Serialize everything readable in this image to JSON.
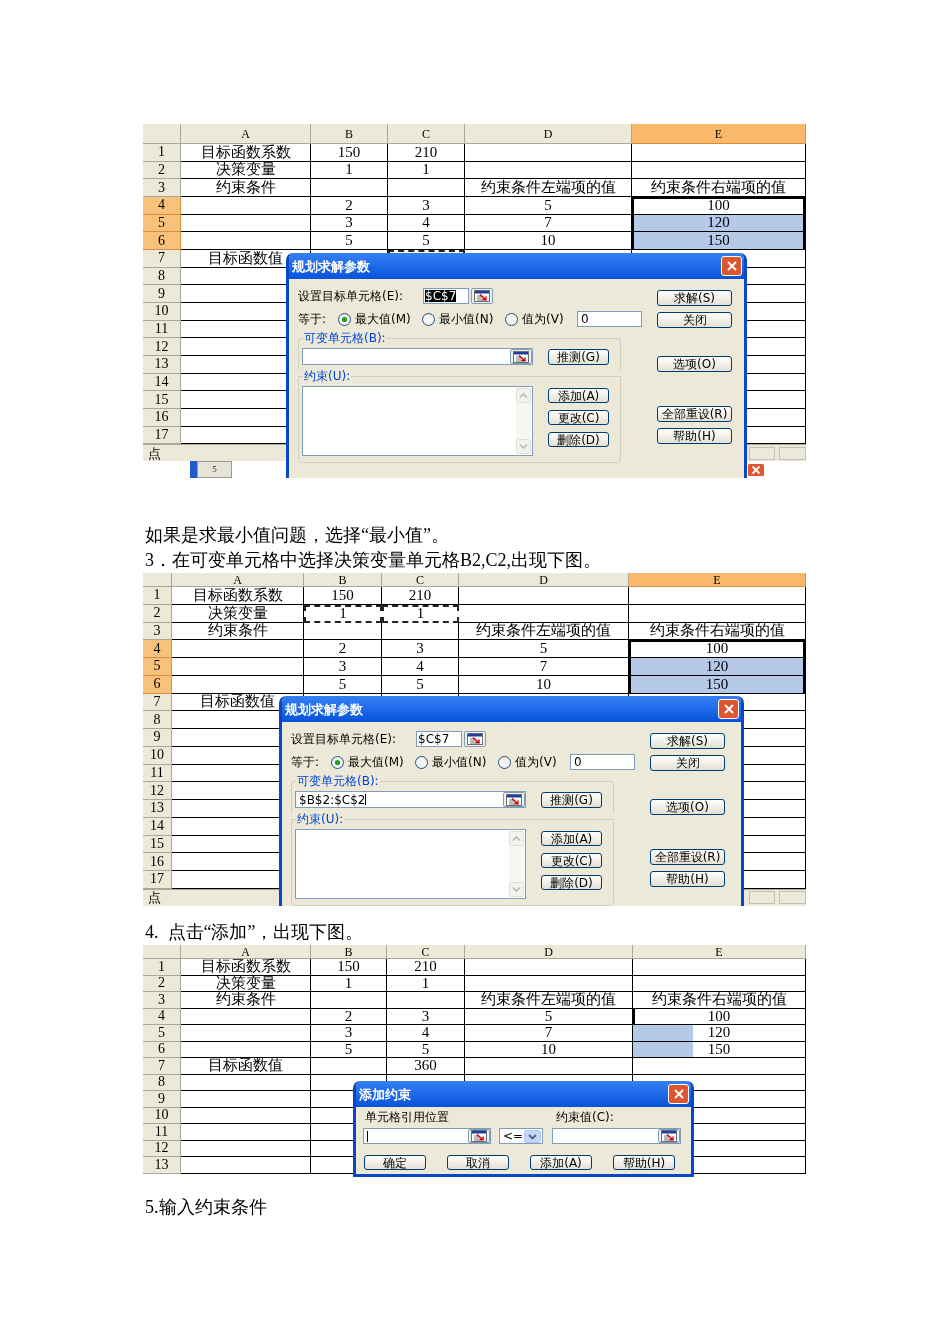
{
  "content": [
    {
      "kind": "screenshot",
      "columns": [
        {
          "label": "A",
          "selected": false
        },
        {
          "label": "B",
          "selected": false
        },
        {
          "label": "C",
          "selected": false
        },
        {
          "label": "D",
          "selected": false
        },
        {
          "label": "E",
          "selected": true
        }
      ],
      "rows": [
        {
          "number": "1",
          "selected": false,
          "cells": [
            {
              "text": "目标函数系数",
              "kind": "plain"
            },
            {
              "text": "150",
              "kind": "plain"
            },
            {
              "text": "210",
              "kind": "plain"
            },
            null,
            null
          ]
        },
        {
          "number": "2",
          "selected": false,
          "cells": [
            {
              "text": "决策变量",
              "kind": "plain"
            },
            {
              "text": "1",
              "kind": "plain"
            },
            {
              "text": "1",
              "kind": "plain"
            },
            null,
            null
          ]
        },
        {
          "number": "3",
          "selected": false,
          "cells": [
            {
              "text": "约束条件",
              "kind": "plain"
            },
            null,
            null,
            {
              "text": "约束条件左端项的值",
              "kind": "plain"
            },
            {
              "text": "约束条件右端项的值",
              "kind": "plain"
            }
          ]
        },
        {
          "number": "4",
          "selected": true,
          "cells": [
            null,
            {
              "text": "2",
              "kind": "plain"
            },
            {
              "text": "3",
              "kind": "plain"
            },
            {
              "text": "5",
              "kind": "plain"
            },
            {
              "text": "100",
              "kind": "active"
            }
          ]
        },
        {
          "number": "5",
          "selected": true,
          "cells": [
            null,
            {
              "text": "3",
              "kind": "plain"
            },
            {
              "text": "4",
              "kind": "plain"
            },
            {
              "text": "7",
              "kind": "plain"
            },
            {
              "text": "120",
              "kind": "selected"
            }
          ]
        },
        {
          "number": "6",
          "selected": true,
          "cells": [
            null,
            {
              "text": "5",
              "kind": "plain"
            },
            {
              "text": "5",
              "kind": "plain"
            },
            {
              "text": "10",
              "kind": "plain"
            },
            {
              "text": "150",
              "kind": "selected"
            }
          ]
        },
        {
          "number": "7",
          "selected": false,
          "cells": [
            {
              "text": "目标函数值",
              "kind": "plain"
            },
            null,
            {
              "kind": "marquee"
            },
            null,
            null
          ]
        },
        {
          "number": "8",
          "selected": false
        },
        {
          "number": "9",
          "selected": false
        },
        {
          "number": "10",
          "selected": false
        },
        {
          "number": "11",
          "selected": false
        },
        {
          "number": "12",
          "selected": false
        },
        {
          "number": "13",
          "selected": false
        },
        {
          "number": "14",
          "selected": false
        },
        {
          "number": "15",
          "selected": false
        },
        {
          "number": "16",
          "selected": false
        },
        {
          "number": "17",
          "selected": false
        }
      ],
      "status_bar": "点",
      "background_tab": "5",
      "dialog": {
        "kind": "solver",
        "title": "规划求解参数",
        "target": {
          "label": "设置目标单元格(E):",
          "value": "$C$7",
          "selected": true
        },
        "equal_label": "等于:",
        "options": [
          {
            "label": "最大值(M)",
            "selected": true
          },
          {
            "label": "最小值(N)",
            "selected": false
          },
          {
            "label": "值为(V)",
            "selected": false
          }
        ],
        "value": "0",
        "changing_cells": {
          "label": "可变单元格(B):",
          "focused": false
        },
        "guess_button": "推测(G)",
        "constraints_label": "约束(U):",
        "constraint_buttons": [
          "添加(A)",
          "更改(C)",
          "删除(D)"
        ],
        "side_buttons": [
          [
            "求解(S)",
            "关闭"
          ],
          [
            "选项(O)"
          ],
          [
            "全部重设(R)",
            "帮助(H)"
          ]
        ]
      }
    },
    {
      "kind": "paragraph",
      "text": "如果是求最小值问题，选择“最小值”。"
    },
    {
      "kind": "paragraph",
      "text": "3．在可变单元格中选择决策变量单元格B2,C2,出现下图。"
    },
    {
      "kind": "screenshot",
      "columns": [
        {
          "label": "A",
          "selected": false
        },
        {
          "label": "B",
          "selected": false
        },
        {
          "label": "C",
          "selected": false
        },
        {
          "label": "D",
          "selected": false
        },
        {
          "label": "E",
          "selected": true
        }
      ],
      "rows": [
        {
          "number": "1",
          "selected": false,
          "cells": [
            {
              "text": "目标函数系数",
              "kind": "plain"
            },
            {
              "text": "150",
              "kind": "plain"
            },
            {
              "text": "210",
              "kind": "plain"
            },
            null,
            null
          ]
        },
        {
          "number": "2",
          "selected": false,
          "cells": [
            {
              "text": "决策变量",
              "kind": "plain"
            },
            {
              "text": "1",
              "kind": "marquee"
            },
            {
              "text": "1",
              "kind": "marquee"
            },
            null,
            null
          ]
        },
        {
          "number": "3",
          "selected": false,
          "cells": [
            {
              "text": "约束条件",
              "kind": "plain"
            },
            null,
            null,
            {
              "text": "约束条件左端项的值",
              "kind": "plain"
            },
            {
              "text": "约束条件右端项的值",
              "kind": "plain"
            }
          ]
        },
        {
          "number": "4",
          "selected": true,
          "cells": [
            null,
            {
              "text": "2",
              "kind": "plain"
            },
            {
              "text": "3",
              "kind": "plain"
            },
            {
              "text": "5",
              "kind": "plain"
            },
            {
              "text": "100",
              "kind": "active"
            }
          ]
        },
        {
          "number": "5",
          "selected": true,
          "cells": [
            null,
            {
              "text": "3",
              "kind": "plain"
            },
            {
              "text": "4",
              "kind": "plain"
            },
            {
              "text": "7",
              "kind": "plain"
            },
            {
              "text": "120",
              "kind": "selected"
            }
          ]
        },
        {
          "number": "6",
          "selected": true,
          "cells": [
            null,
            {
              "text": "5",
              "kind": "plain"
            },
            {
              "text": "5",
              "kind": "plain"
            },
            {
              "text": "10",
              "kind": "plain"
            },
            {
              "text": "150",
              "kind": "selected"
            }
          ]
        },
        {
          "number": "7",
          "selected": false,
          "cells": [
            {
              "text": "目标函数值",
              "kind": "plain"
            },
            null,
            null,
            null,
            null
          ]
        },
        {
          "number": "8",
          "selected": false
        },
        {
          "number": "9",
          "selected": false
        },
        {
          "number": "10",
          "selected": false
        },
        {
          "number": "11",
          "selected": false
        },
        {
          "number": "12",
          "selected": false
        },
        {
          "number": "13",
          "selected": false
        },
        {
          "number": "14",
          "selected": false
        },
        {
          "number": "15",
          "selected": false
        },
        {
          "number": "16",
          "selected": false
        },
        {
          "number": "17",
          "selected": false
        }
      ],
      "status_bar": "点",
      "dialog": {
        "kind": "solver",
        "title": "规划求解参数",
        "target": {
          "label": "设置目标单元格(E):",
          "value": "$C$7",
          "selected": false
        },
        "equal_label": "等于:",
        "options": [
          {
            "label": "最大值(M)",
            "selected": true
          },
          {
            "label": "最小值(N)",
            "selected": false
          },
          {
            "label": "值为(V)",
            "selected": false
          }
        ],
        "value": "0",
        "changing_cells": {
          "label": "可变单元格(B):",
          "value": "$B$2:$C$2",
          "focused": true
        },
        "guess_button": "推测(G)",
        "constraints_label": "约束(U):",
        "constraint_buttons": [
          "添加(A)",
          "更改(C)",
          "删除(D)"
        ],
        "side_buttons": [
          [
            "求解(S)",
            "关闭"
          ],
          [
            "选项(O)"
          ],
          [
            "全部重设(R)",
            "帮助(H)"
          ]
        ]
      }
    },
    {
      "kind": "paragraph",
      "text": "4.  点击“添加”，出现下图。"
    },
    {
      "kind": "screenshot",
      "columns": [
        {
          "label": "A",
          "selected": false
        },
        {
          "label": "B",
          "selected": false
        },
        {
          "label": "C",
          "selected": false
        },
        {
          "label": "D",
          "selected": false
        },
        {
          "label": "E",
          "selected": false
        }
      ],
      "rows": [
        {
          "number": "1",
          "selected": false,
          "cells": [
            {
              "text": "目标函数系数",
              "kind": "plain"
            },
            {
              "text": "150",
              "kind": "plain"
            },
            {
              "text": "210",
              "kind": "plain"
            },
            null,
            null
          ]
        },
        {
          "number": "2",
          "selected": false,
          "cells": [
            {
              "text": "决策变量",
              "kind": "plain"
            },
            {
              "text": "1",
              "kind": "plain"
            },
            {
              "text": "1",
              "kind": "plain"
            },
            null,
            null
          ]
        },
        {
          "number": "3",
          "selected": false,
          "cells": [
            {
              "text": "约束条件",
              "kind": "plain"
            },
            null,
            null,
            {
              "text": "约束条件左端项的值",
              "kind": "plain"
            },
            {
              "text": "约束条件右端项的值",
              "kind": "plain"
            }
          ]
        },
        {
          "number": "4",
          "selected": false,
          "cells": [
            null,
            {
              "text": "2",
              "kind": "plain"
            },
            {
              "text": "3",
              "kind": "plain"
            },
            {
              "text": "5",
              "kind": "plain"
            },
            {
              "text": "100",
              "kind": "edge"
            }
          ]
        },
        {
          "number": "5",
          "selected": false,
          "cells": [
            null,
            {
              "text": "3",
              "kind": "plain"
            },
            {
              "text": "4",
              "kind": "plain"
            },
            {
              "text": "7",
              "kind": "plain"
            },
            {
              "text": "120",
              "kind": "partial"
            }
          ]
        },
        {
          "number": "6",
          "selected": false,
          "cells": [
            null,
            {
              "text": "5",
              "kind": "plain"
            },
            {
              "text": "5",
              "kind": "plain"
            },
            {
              "text": "10",
              "kind": "plain"
            },
            {
              "text": "150",
              "kind": "partial"
            }
          ]
        },
        {
          "number": "7",
          "selected": false,
          "cells": [
            {
              "text": "目标函数值",
              "kind": "plain"
            },
            null,
            {
              "text": "360",
              "kind": "plain"
            },
            null,
            null
          ]
        },
        {
          "number": "8",
          "selected": false
        },
        {
          "number": "9",
          "selected": false
        },
        {
          "number": "10",
          "selected": false
        },
        {
          "number": "11",
          "selected": false
        },
        {
          "number": "12",
          "selected": false
        },
        {
          "number": "13",
          "selected": false
        }
      ],
      "dialog": {
        "kind": "add_constraint",
        "title": "添加约束",
        "reference": {
          "label": "单元格引用位置",
          "focused": true
        },
        "operator": "<=",
        "constraint": {
          "label": "约束值(C):",
          "focused": false
        },
        "buttons": [
          "确定",
          "取消",
          "添加(A)",
          "帮助(H)"
        ]
      }
    },
    {
      "kind": "paragraph",
      "text": "5.输入约束条件"
    }
  ]
}
